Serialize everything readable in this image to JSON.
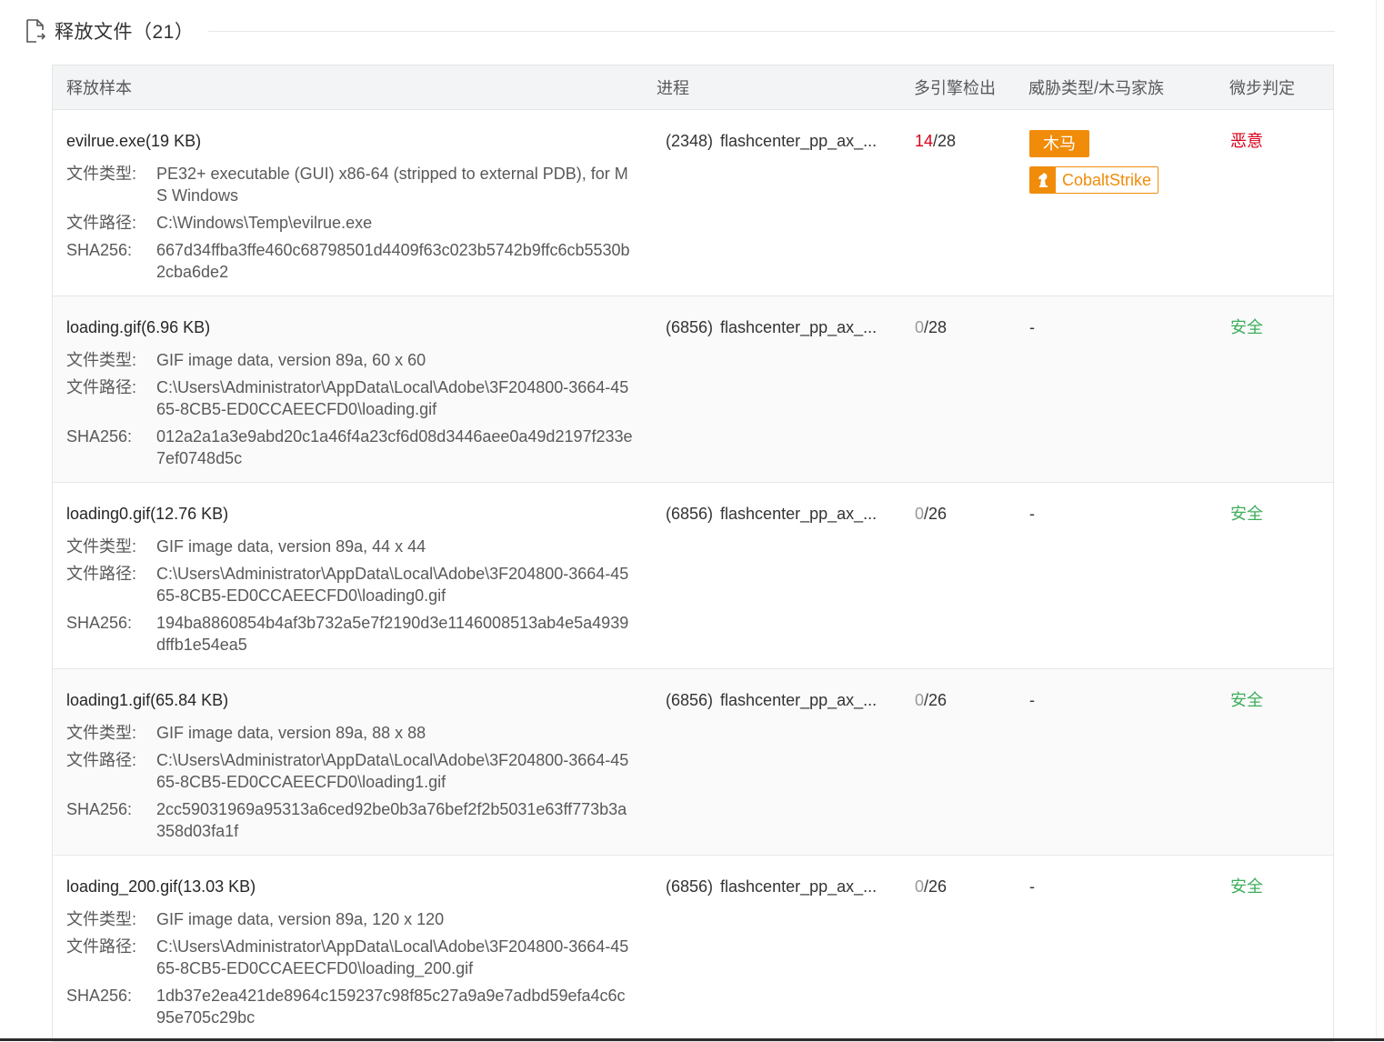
{
  "section": {
    "title": "释放文件（21）",
    "icon": "document-export-icon"
  },
  "columns": {
    "sample": "释放样本",
    "process": "进程",
    "engines": "多引擎检出",
    "threat": "威胁类型/木马家族",
    "verdict": "微步判定"
  },
  "labels": {
    "file_type": "文件类型:",
    "file_path": "文件路径:",
    "sha256": "SHA256:"
  },
  "rows": [
    {
      "name": "evilrue.exe(19 KB)",
      "file_type": "PE32+ executable (GUI) x86-64 (stripped to external PDB), for MS Windows",
      "file_path": "C:\\Windows\\Temp\\evilrue.exe",
      "sha256": "667d34ffba3ffe460c68798501d4409f63c023b5742b9ffc6cb5530b2cba6de2",
      "pid": "(2348)",
      "process": "flashcenter_pp_ax_...",
      "hits": "14",
      "total": "/28",
      "threat_type": "木马",
      "family": "CobaltStrike",
      "family_icon": "chess-knight-icon",
      "verdict": "恶意"
    },
    {
      "name": "loading.gif(6.96 KB)",
      "file_type": "GIF image data, version 89a, 60 x 60",
      "file_path": "C:\\Users\\Administrator\\AppData\\Local\\Adobe\\3F204800-3664-4565-8CB5-ED0CCAEECFD0\\loading.gif",
      "sha256": "012a2a1a3e9abd20c1a46f4a23cf6d08d3446aee0a49d2197f233e7ef0748d5c",
      "pid": "(6856)",
      "process": "flashcenter_pp_ax_...",
      "hits": "0",
      "total": "/28",
      "threat_type": "-",
      "verdict": "安全"
    },
    {
      "name": "loading0.gif(12.76 KB)",
      "file_type": "GIF image data, version 89a, 44 x 44",
      "file_path": "C:\\Users\\Administrator\\AppData\\Local\\Adobe\\3F204800-3664-4565-8CB5-ED0CCAEECFD0\\loading0.gif",
      "sha256": "194ba8860854b4af3b732a5e7f2190d3e1146008513ab4e5a4939dffb1e54ea5",
      "pid": "(6856)",
      "process": "flashcenter_pp_ax_...",
      "hits": "0",
      "total": "/26",
      "threat_type": "-",
      "verdict": "安全"
    },
    {
      "name": "loading1.gif(65.84 KB)",
      "file_type": "GIF image data, version 89a, 88 x 88",
      "file_path": "C:\\Users\\Administrator\\AppData\\Local\\Adobe\\3F204800-3664-4565-8CB5-ED0CCAEECFD0\\loading1.gif",
      "sha256": "2cc59031969a95313a6ced92be0b3a76bef2f2b5031e63ff773b3a358d03fa1f",
      "pid": "(6856)",
      "process": "flashcenter_pp_ax_...",
      "hits": "0",
      "total": "/26",
      "threat_type": "-",
      "verdict": "安全"
    },
    {
      "name": "loading_200.gif(13.03 KB)",
      "file_type": "GIF image data, version 89a, 120 x 120",
      "file_path": "C:\\Users\\Administrator\\AppData\\Local\\Adobe\\3F204800-3664-4565-8CB5-ED0CCAEECFD0\\loading_200.gif",
      "sha256": "1db37e2ea421de8964c159237c98f85c27a9a9e7adbd59efa4c6c95e705c29bc",
      "pid": "(6856)",
      "process": "flashcenter_pp_ax_...",
      "hits": "0",
      "total": "/26",
      "threat_type": "-",
      "verdict": "安全"
    }
  ],
  "colors": {
    "malicious": "#d9001b",
    "safe": "#3dae5b",
    "trojan_tag": "#f08c0a",
    "header_bg": "#f3f4f6"
  }
}
